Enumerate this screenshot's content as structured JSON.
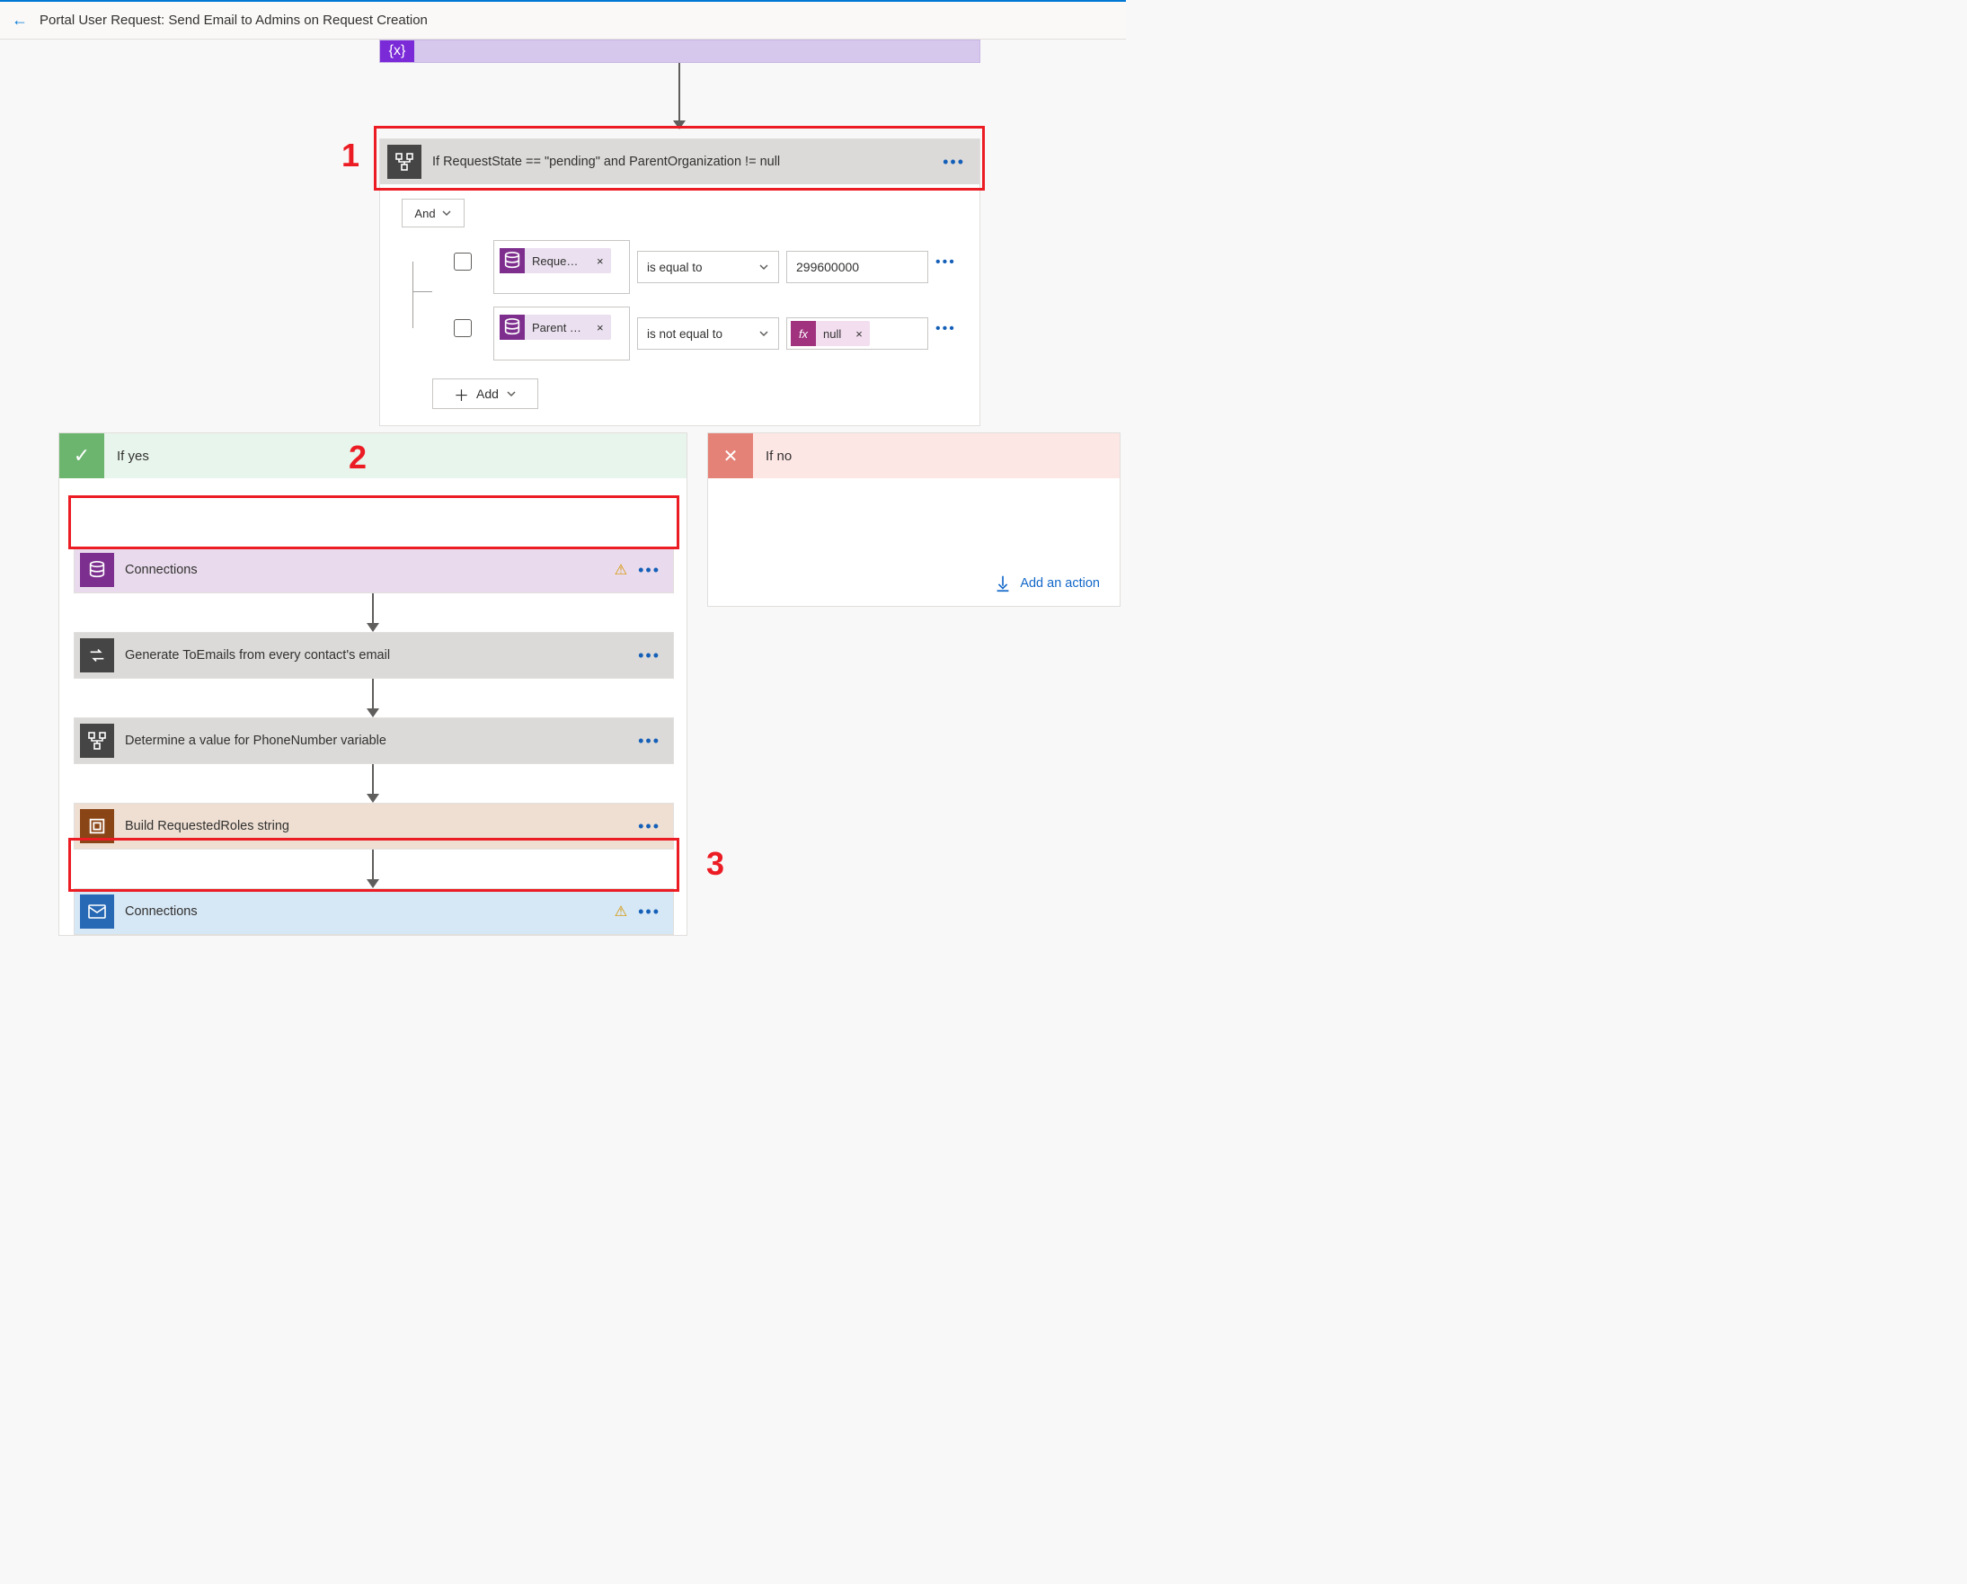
{
  "header": {
    "title": "Portal User Request: Send Email to Admins on Request Creation",
    "back_label": "Back"
  },
  "purple_stub": {
    "icon": "variable-icon"
  },
  "condition": {
    "title": "If RequestState == \"pending\" and ParentOrganization != null",
    "more": "•••",
    "group_op": "And",
    "rows": [
      {
        "left_token": "Request …",
        "op": "is equal to",
        "value": "299600000",
        "token_style": "purple"
      },
      {
        "left_token": "Parent O…",
        "op": "is not equal to",
        "value_token": "null",
        "token_style": "purple",
        "value_style": "pink"
      }
    ],
    "add_label": "Add"
  },
  "yes": {
    "label": "If yes",
    "steps": {
      "conn1": {
        "label": "Connections",
        "warn": true
      },
      "gen": {
        "label": "Generate ToEmails from every contact's email"
      },
      "det": {
        "label": "Determine a value for PhoneNumber variable"
      },
      "build": {
        "label": "Build RequestedRoles string"
      },
      "conn2": {
        "label": "Connections",
        "warn": true
      }
    }
  },
  "no": {
    "label": "If no",
    "add_action": "Add an action"
  },
  "annotations": {
    "n1": "1",
    "n2": "2",
    "n3": "3"
  }
}
